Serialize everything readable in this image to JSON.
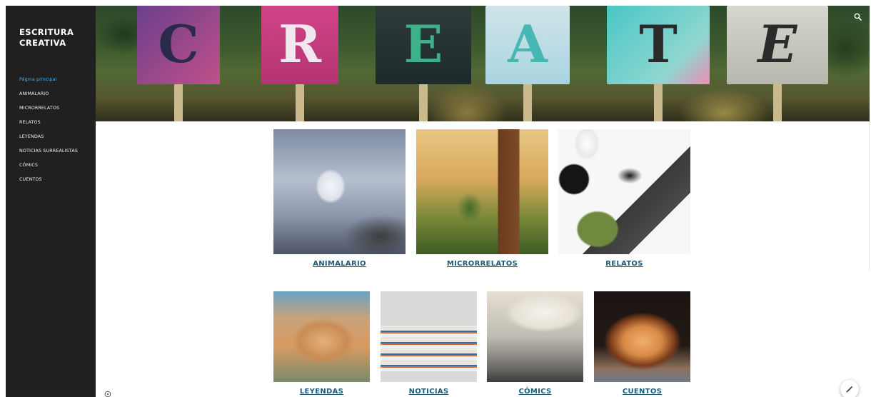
{
  "sidebar": {
    "site_title": "ESCRITURA CREATIVA",
    "nav": [
      {
        "label": "Página principal",
        "active": true
      },
      {
        "label": "ANIMALARIO",
        "active": false
      },
      {
        "label": "MICRORRELATOS",
        "active": false
      },
      {
        "label": "RELATOS",
        "active": false
      },
      {
        "label": "LEYENDAS",
        "active": false
      },
      {
        "label": "NOTICIAS SURREALISTAS",
        "active": false
      },
      {
        "label": "CÓMICS",
        "active": false
      },
      {
        "label": "CUENTOS",
        "active": false
      }
    ]
  },
  "banner": {
    "letters": [
      "C",
      "R",
      "E",
      "A",
      "T",
      "E"
    ]
  },
  "tiles": {
    "animalario": "ANIMALARIO ",
    "microrrelatos": "MICRORRELATOS",
    "relatos": "RELATOS",
    "leyendas": "LEYENDAS",
    "noticias": "NOTICIAS",
    "comics": "CÓMICS",
    "cuentos": "CUENTOS"
  },
  "icons": {
    "search": "search-icon",
    "info": "info-icon",
    "edit": "pencil-icon"
  },
  "colors": {
    "sidebar_bg": "#202020",
    "active_nav": "#4fb3ea",
    "link": "#1d5b78"
  }
}
